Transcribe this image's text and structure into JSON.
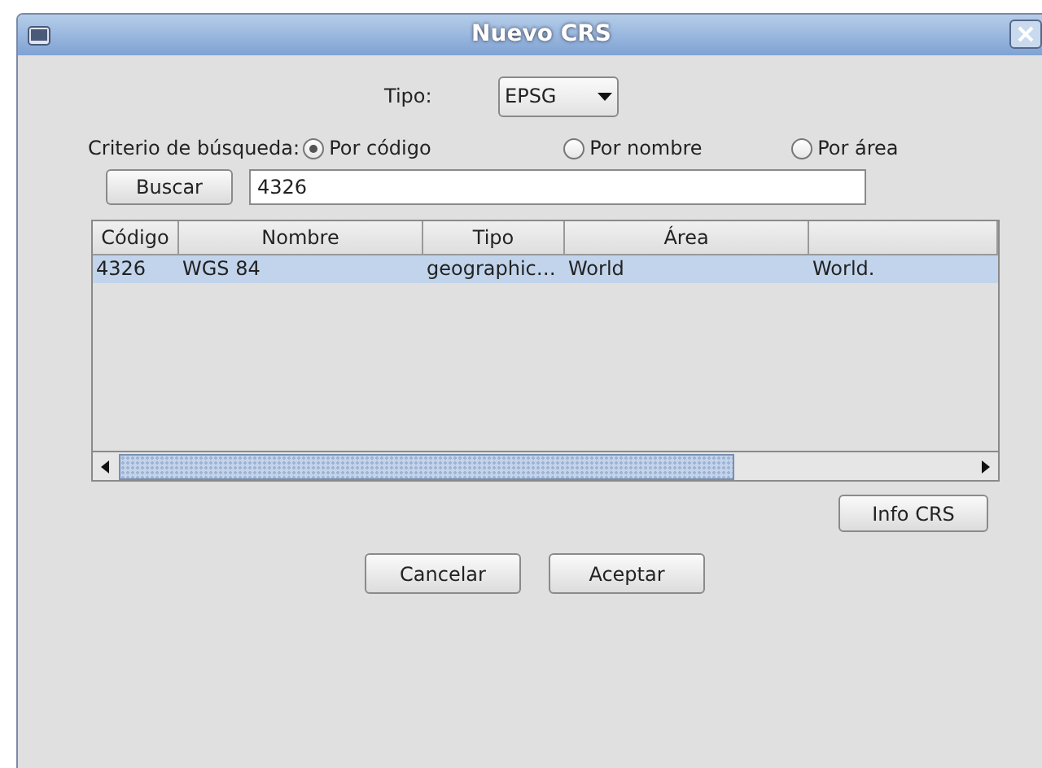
{
  "window": {
    "title": "Nuevo CRS"
  },
  "tipo": {
    "label": "Tipo:",
    "value": "EPSG"
  },
  "criterio": {
    "label": "Criterio de búsqueda:",
    "options": [
      {
        "label": "Por código",
        "selected": true
      },
      {
        "label": "Por nombre",
        "selected": false
      },
      {
        "label": "Por área",
        "selected": false
      }
    ]
  },
  "search": {
    "button": "Buscar",
    "value": "4326"
  },
  "table": {
    "columns": [
      "Código",
      "Nombre",
      "Tipo",
      "Área",
      ""
    ],
    "rows": [
      {
        "cells": [
          "4326",
          "WGS 84",
          "geographic…",
          "World",
          "World."
        ],
        "selected": true
      }
    ]
  },
  "info_button": "Info CRS",
  "buttons": [
    "Cancelar",
    "Aceptar"
  ]
}
